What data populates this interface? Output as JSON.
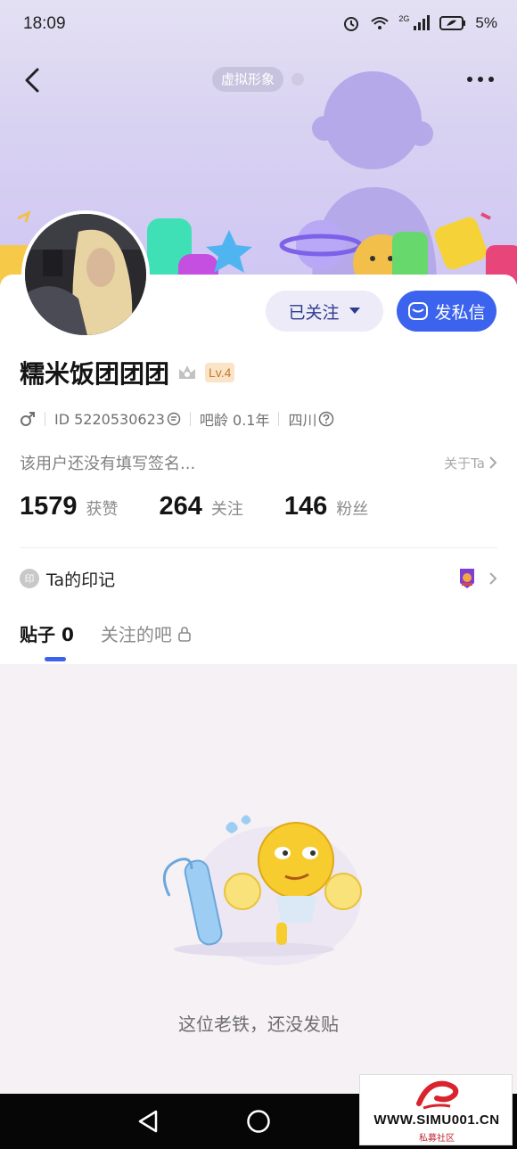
{
  "status_bar": {
    "time": "18:09",
    "network": "2G",
    "battery": "5%"
  },
  "header": {
    "virtual_tag": "虚拟形象"
  },
  "profile": {
    "username": "糯米饭团团团",
    "level": "Lv.4",
    "id_label": "ID 5220530623",
    "age_label": "吧龄 0.1年",
    "location": "四川",
    "signature": "该用户还没有填写签名...",
    "about_label": "关于Ta"
  },
  "actions": {
    "follow_label": "已关注",
    "message_label": "发私信"
  },
  "stats": [
    {
      "value": "1579",
      "label": "获赞"
    },
    {
      "value": "264",
      "label": "关注"
    },
    {
      "value": "146",
      "label": "粉丝"
    }
  ],
  "imprint": {
    "icon_text": "印",
    "title": "Ta的印记"
  },
  "tabs": [
    {
      "label": "贴子 0"
    },
    {
      "label": "关注的吧"
    }
  ],
  "empty_state": {
    "text": "这位老铁，还没发贴"
  },
  "watermark": {
    "url": "WWW.SIMU001.CN",
    "sub": "私募社区"
  },
  "colors": {
    "accent": "#3b63ee",
    "header_bg": "#d8d2f2",
    "level_bg": "#fbe3c8"
  }
}
